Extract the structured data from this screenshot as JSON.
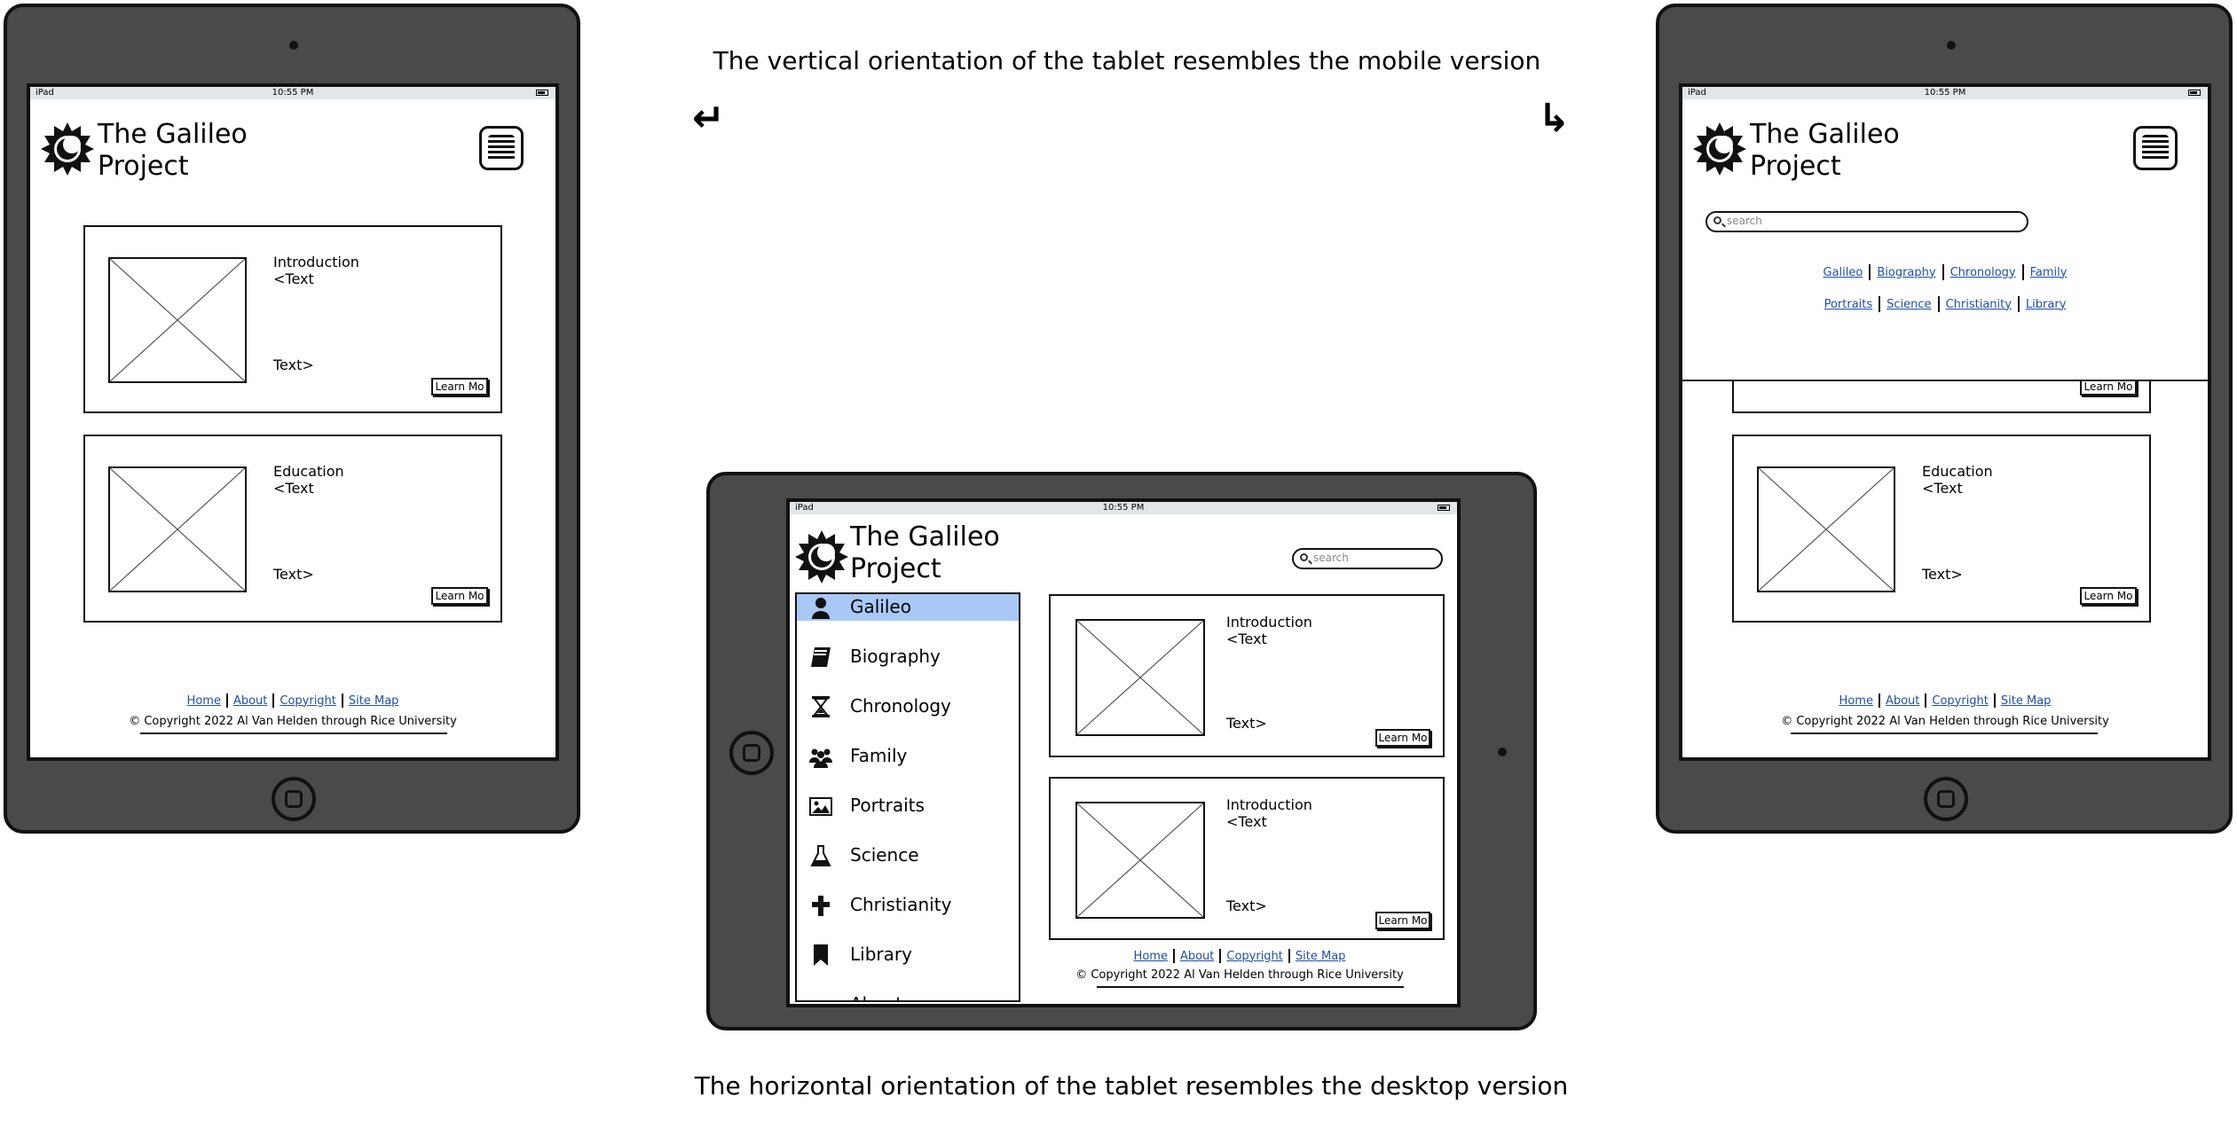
{
  "captions": {
    "vertical": "The vertical orientation of the tablet resembles the mobile version",
    "horizontal": "The horizontal orientation of the tablet resembles the desktop version",
    "arrow_left": "↵",
    "arrow_right": "↳"
  },
  "status": {
    "device": "iPad",
    "time": "10:55 PM"
  },
  "site": {
    "title_line1": "The Galileo",
    "title_line2": "Project"
  },
  "cards_portrait": [
    {
      "heading": "Introduction",
      "text_start": "<Text",
      "text_end": "Text>",
      "button": "Learn Mo"
    },
    {
      "heading": "Education",
      "text_start": "<Text",
      "text_end": "Text>",
      "button": "Learn Mo"
    }
  ],
  "cards_landscape": [
    {
      "heading": "Introduction",
      "text_start": "<Text",
      "text_end": "Text>",
      "button": "Learn Mo"
    },
    {
      "heading": "Introduction",
      "text_start": "<Text",
      "text_end": "Text>",
      "button": "Learn Mo"
    }
  ],
  "footer": {
    "links": [
      "Home",
      "About",
      "Copyright",
      "Site Map"
    ],
    "copyright": "© Copyright 2022 Al Van Helden through Rice University"
  },
  "search": {
    "placeholder": "search"
  },
  "menu_links_row1": [
    "Galileo",
    "Biography",
    "Chronology",
    "Family"
  ],
  "menu_links_row2": [
    "Portraits",
    "Science",
    "Christianity",
    "Library"
  ],
  "sidebar": {
    "items": [
      {
        "label": "Galileo",
        "icon": "person-icon",
        "selected": true
      },
      {
        "label": "Biography",
        "icon": "book-icon"
      },
      {
        "label": "Chronology",
        "icon": "hourglass-icon"
      },
      {
        "label": "Family",
        "icon": "family-icon"
      },
      {
        "label": "Portraits",
        "icon": "picture-icon"
      },
      {
        "label": "Science",
        "icon": "flask-icon"
      },
      {
        "label": "Christianity",
        "icon": "cross-icon"
      },
      {
        "label": "Library",
        "icon": "bookmark-icon"
      },
      {
        "label": "About",
        "icon": ""
      }
    ],
    "selected_color": "#a9c8f5"
  },
  "colors": {
    "tablet_body": "#4a4a4a",
    "link": "#1f4fa8",
    "statusbar": "#e2e6e8"
  }
}
